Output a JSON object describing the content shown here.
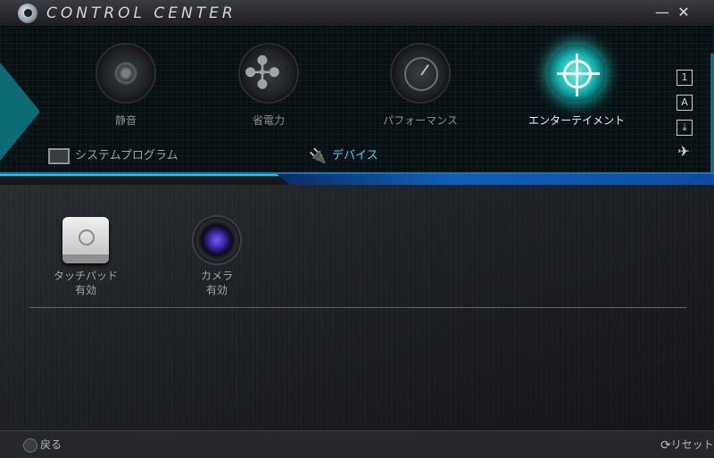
{
  "window": {
    "title": "CONTROL CENTER",
    "minimize_glyph": "—",
    "close_glyph": "✕"
  },
  "modes": [
    {
      "label": "静音",
      "icon": "speaker-icon",
      "selected": false
    },
    {
      "label": "省電力",
      "icon": "fan-icon",
      "selected": false
    },
    {
      "label": "パフォーマンス",
      "icon": "gauge-icon",
      "selected": false
    },
    {
      "label": "エンターテイメント",
      "icon": "target-icon",
      "selected": true
    }
  ],
  "side_icons": [
    "1",
    "A",
    "⤓",
    "✈"
  ],
  "tabs": {
    "system": "システムプログラム",
    "devices": "デバイス"
  },
  "devices": [
    {
      "name": "タッチパッド",
      "status": "有効",
      "icon": "touchpad-icon"
    },
    {
      "name": "カメラ",
      "status": "有効",
      "icon": "camera-icon"
    }
  ],
  "footer": {
    "back": "戻る",
    "reset": "リセット",
    "reset_glyph": "⟳"
  },
  "colors": {
    "accent": "#0ad5e0",
    "active_tab": "#3fd8ff"
  }
}
